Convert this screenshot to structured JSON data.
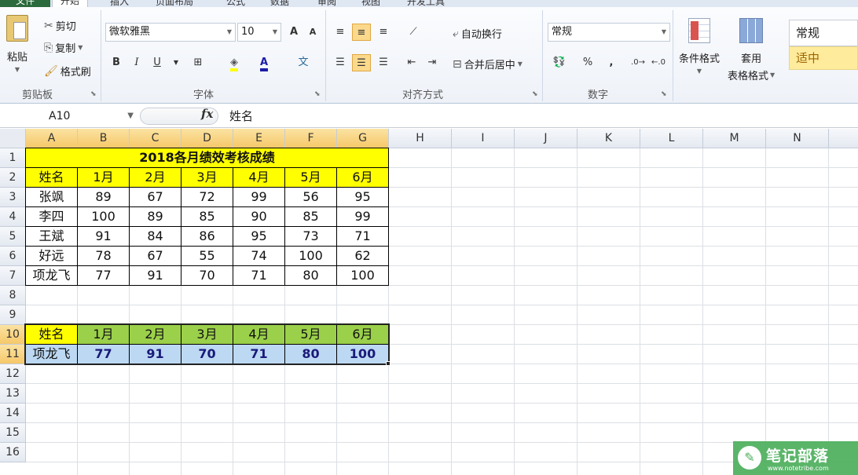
{
  "tabs": [
    "文件",
    "开始",
    "插入",
    "页面布局",
    "公式",
    "数据",
    "审阅",
    "视图",
    "开发工具"
  ],
  "ribbon": {
    "clipboard": {
      "paste": "粘贴",
      "cut": "剪切",
      "copy": "复制",
      "format_painter": "格式刷",
      "label": "剪贴板"
    },
    "font": {
      "name": "微软雅黑",
      "size": "10",
      "grow": "A",
      "shrink": "A",
      "bold": "B",
      "italic": "I",
      "underline": "U",
      "phonetic": "文",
      "label": "字体"
    },
    "alignment": {
      "wrap": "自动换行",
      "merge": "合并后居中",
      "label": "对齐方式"
    },
    "number": {
      "format": "常规",
      "percent": "%",
      "comma": ",",
      "label": "数字"
    },
    "styles": {
      "conditional": "条件格式",
      "table_format_1": "套用",
      "table_format_2": "表格格式",
      "normal": "常规",
      "neutral": "适中"
    }
  },
  "formula_bar": {
    "name_box": "A10",
    "fx": "fx",
    "content": "姓名"
  },
  "columns": [
    "A",
    "B",
    "C",
    "D",
    "E",
    "F",
    "G",
    "H",
    "I",
    "J",
    "K",
    "L",
    "M",
    "N"
  ],
  "rows": [
    "1",
    "2",
    "3",
    "4",
    "5",
    "6",
    "7",
    "8",
    "9",
    "10",
    "11",
    "12",
    "13",
    "14",
    "15",
    "16"
  ],
  "sheet": {
    "title": "2018各月绩效考核成绩",
    "header": [
      "姓名",
      "1月",
      "2月",
      "3月",
      "4月",
      "5月",
      "6月"
    ],
    "data": [
      [
        "张飒",
        "89",
        "67",
        "72",
        "99",
        "56",
        "95"
      ],
      [
        "李四",
        "100",
        "89",
        "85",
        "90",
        "85",
        "99"
      ],
      [
        "王斌",
        "91",
        "84",
        "86",
        "95",
        "73",
        "71"
      ],
      [
        "好远",
        "78",
        "67",
        "55",
        "74",
        "100",
        "62"
      ],
      [
        "项龙飞",
        "77",
        "91",
        "70",
        "71",
        "80",
        "100"
      ]
    ],
    "lookup_header": [
      "姓名",
      "1月",
      "2月",
      "3月",
      "4月",
      "5月",
      "6月"
    ],
    "lookup_row": [
      "项龙飞",
      "77",
      "91",
      "70",
      "71",
      "80",
      "100"
    ]
  },
  "watermark": {
    "title": "笔记部落",
    "url": "www.notetribe.com",
    "logo": "✎"
  }
}
